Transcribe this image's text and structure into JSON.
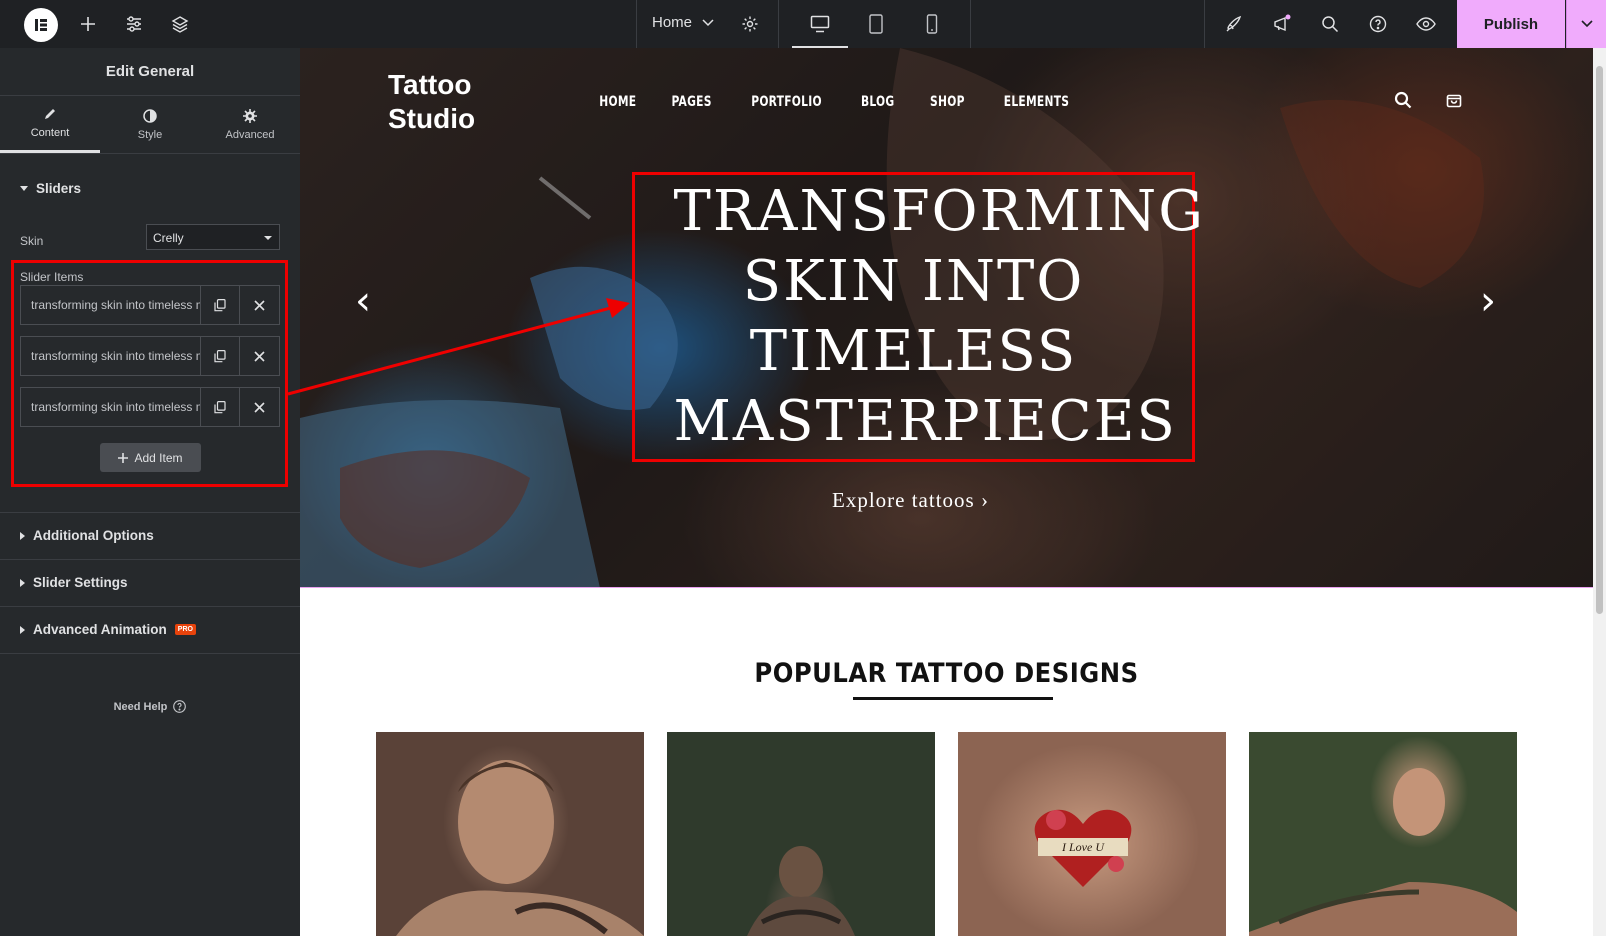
{
  "topbar": {
    "page_name": "Home",
    "publish_label": "Publish",
    "icons": [
      "elementor-logo-icon",
      "plus-icon",
      "settings-sliders-icon",
      "layers-icon",
      "settings-gear-icon",
      "desktop-icon",
      "tablet-icon",
      "mobile-icon",
      "rocket-icon",
      "megaphone-icon",
      "search-icon",
      "help-icon",
      "eye-icon",
      "chevron-down-icon"
    ]
  },
  "sidebar": {
    "title": "Edit General",
    "tabs": [
      {
        "label": "Content",
        "icon": "pencil-icon"
      },
      {
        "label": "Style",
        "icon": "half-circle-icon"
      },
      {
        "label": "Advanced",
        "icon": "gear-icon"
      }
    ],
    "sliders_section": "Sliders",
    "skin_label": "Skin",
    "skin_value": "Crelly",
    "slider_items_label": "Slider Items",
    "slider_items": [
      {
        "text": "transforming skin into timeless masterpieces"
      },
      {
        "text": "transforming skin into timeless masterpieces"
      },
      {
        "text": "transforming skin into timeless masterpieces"
      }
    ],
    "add_item_label": "Add Item",
    "sections": [
      {
        "label": "Additional Options"
      },
      {
        "label": "Slider Settings"
      },
      {
        "label": "Advanced Animation",
        "badge": "PRO"
      }
    ],
    "need_help": "Need Help"
  },
  "site": {
    "logo_line1": "Tattoo",
    "logo_line2": "Studio",
    "nav": [
      "HOME",
      "PAGES",
      "PORTFOLIO",
      "BLOG",
      "SHOP",
      "ELEMENTS"
    ],
    "hero_title": "TRANSFORMING SKIN INTO TIMELESS MASTERPIECES",
    "hero_cta": "Explore tattoos ›",
    "popular_title": "POPULAR TATTOO DESIGNS",
    "card_tattoo_text": "I Love U"
  },
  "colors": {
    "editor_dark": "#1f2124",
    "panel": "#26292c",
    "publish": "#f0abfc",
    "annotation_red": "#ee0000"
  }
}
